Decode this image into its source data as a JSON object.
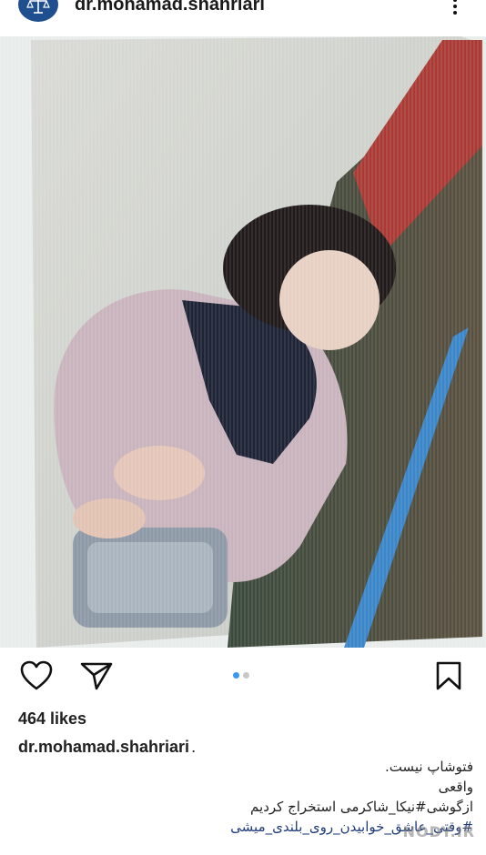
{
  "header": {
    "username": "dr.mohamad.shahriari",
    "avatar_icon": "scales-of-justice-icon",
    "more_icon": "more-vertical-icon"
  },
  "post": {
    "image_alt_icon": "photo",
    "carousel": {
      "count": 2,
      "active_index": 0
    },
    "actions": {
      "like_icon": "heart-icon",
      "share_icon": "paper-plane-icon",
      "save_icon": "bookmark-icon"
    },
    "likes": "464 likes",
    "caption": {
      "username": "dr.mohamad.shahriari",
      "suffix": ".",
      "lines": [
        "فتوشاپ نیست.",
        "واقعی",
        "ازگوشی#نیکا_شاکرمی استخراج کردیم",
        "#وقتی_عاشق_خوابیدن_روی_بلندی_میشی"
      ]
    }
  },
  "watermark": "NODY.IR",
  "colors": {
    "accent": "#3897f0",
    "avatar": "#1f4f8f",
    "text": "#222222"
  }
}
